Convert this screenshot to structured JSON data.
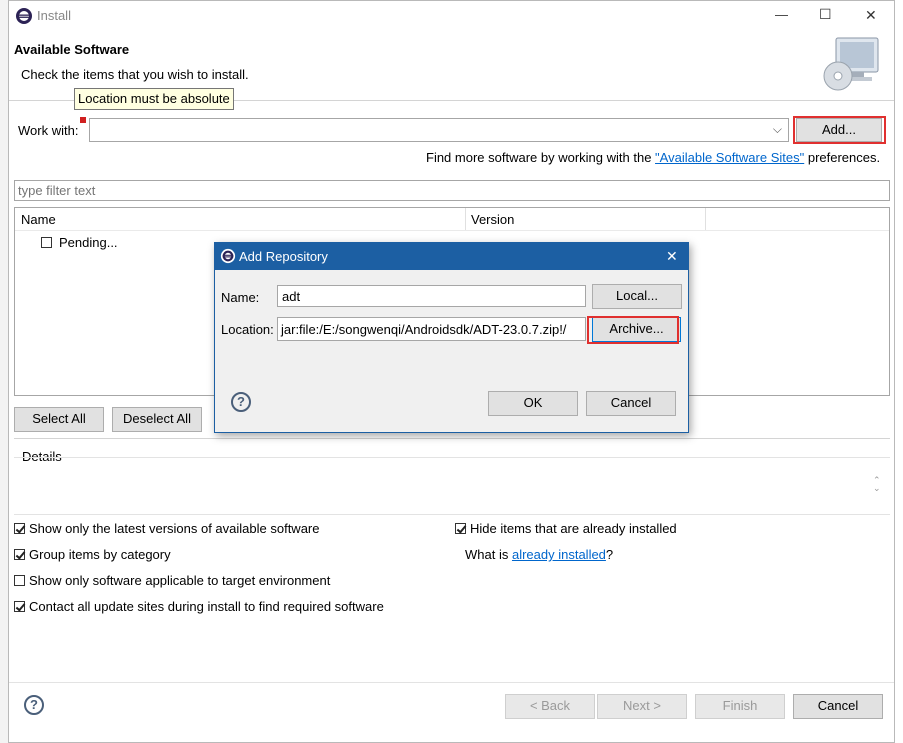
{
  "window": {
    "title": "Install",
    "controls": {
      "minimize": "—",
      "maximize": "☐",
      "close": "✕"
    }
  },
  "header": {
    "title": "Available Software",
    "subtitle": "Check the items that you wish to install."
  },
  "tooltip": {
    "text": "Location must be absolute"
  },
  "work_with": {
    "label": "Work with:",
    "value": "",
    "add_button": "Add...",
    "find_more_prefix": "Find more software by working with the ",
    "find_more_link": "\"Available Software Sites\"",
    "find_more_suffix": " preferences."
  },
  "filter": {
    "placeholder": "type filter text"
  },
  "table": {
    "columns": [
      "Name",
      "Version"
    ],
    "rows": [
      {
        "name": "Pending...",
        "checked": false
      }
    ]
  },
  "buttons": {
    "select_all": "Select All",
    "deselect_all": "Deselect All"
  },
  "details": {
    "label": "Details"
  },
  "options": {
    "latest_versions": {
      "label": "Show only the latest versions of available software",
      "checked": true
    },
    "group_by_category": {
      "label": "Group items by category",
      "checked": true
    },
    "target_env": {
      "label": "Show only software applicable to target environment",
      "checked": false
    },
    "contact_sites": {
      "label": "Contact all update sites during install to find required software",
      "checked": true
    },
    "hide_installed": {
      "label": "Hide items that are already installed",
      "checked": true
    },
    "what_is_prefix": "What is ",
    "what_is_link": "already installed",
    "what_is_suffix": "?"
  },
  "footer": {
    "back": "< Back",
    "next": "Next >",
    "finish": "Finish",
    "cancel": "Cancel",
    "help": "?"
  },
  "dialog": {
    "title": "Add Repository",
    "name_label": "Name:",
    "name_value": "adt",
    "local_button": "Local...",
    "location_label": "Location:",
    "location_value": "jar:file:/E:/songwenqi/Androidsdk/ADT-23.0.7.zip!/",
    "archive_button": "Archive...",
    "ok_button": "OK",
    "cancel_button": "Cancel",
    "help": "?",
    "close": "✕"
  },
  "colors": {
    "accent_blue": "#1c5fa3",
    "highlight_red": "#e0302f",
    "link": "#0066cc"
  }
}
